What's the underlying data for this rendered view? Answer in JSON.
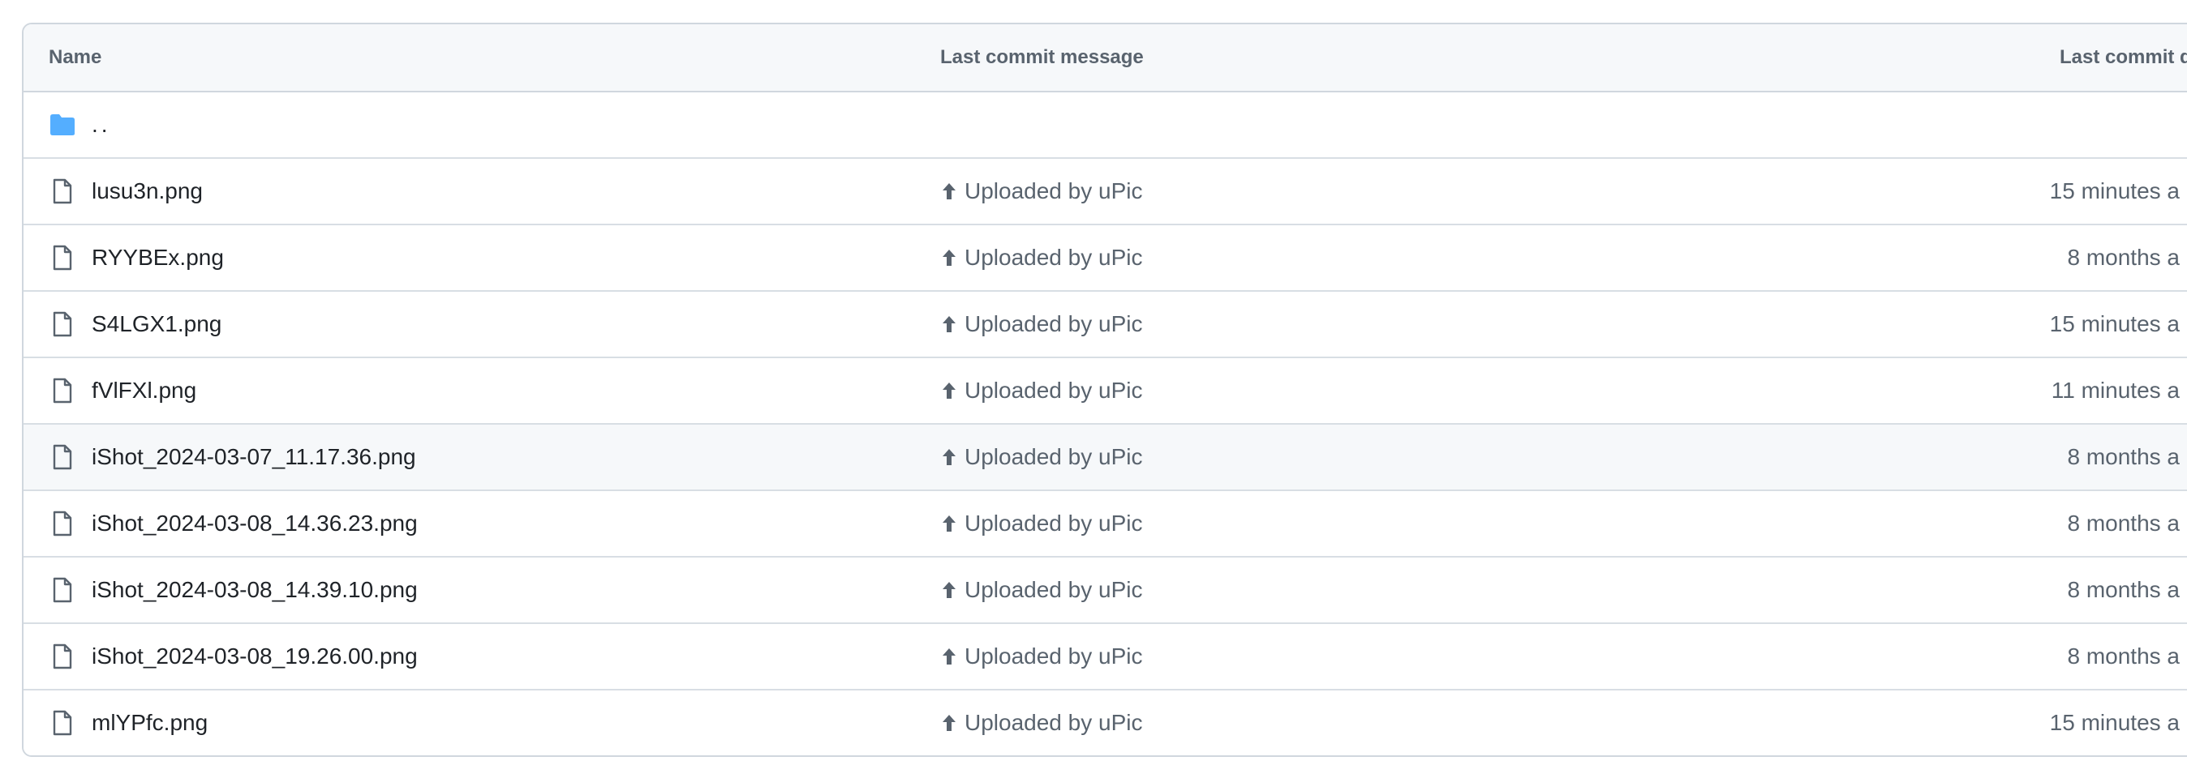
{
  "table": {
    "headers": {
      "name": "Name",
      "message": "Last commit message",
      "date": "Last commit d"
    },
    "parent": {
      "label": "..",
      "icon": "folder-icon",
      "color": "#54aeff"
    },
    "rows": [
      {
        "name": "lusu3n.png",
        "message": "Uploaded by uPic",
        "date": "15 minutes a",
        "highlight": false
      },
      {
        "name": "RYYBEx.png",
        "message": "Uploaded by uPic",
        "date": "8 months a",
        "highlight": false
      },
      {
        "name": "S4LGX1.png",
        "message": "Uploaded by uPic",
        "date": "15 minutes a",
        "highlight": false
      },
      {
        "name": "fVlFXl.png",
        "message": "Uploaded by uPic",
        "date": "11 minutes a",
        "highlight": false
      },
      {
        "name": "iShot_2024-03-07_11.17.36.png",
        "message": "Uploaded by uPic",
        "date": "8 months a",
        "highlight": true
      },
      {
        "name": "iShot_2024-03-08_14.36.23.png",
        "message": "Uploaded by uPic",
        "date": "8 months a",
        "highlight": false
      },
      {
        "name": "iShot_2024-03-08_14.39.10.png",
        "message": "Uploaded by uPic",
        "date": "8 months a",
        "highlight": false
      },
      {
        "name": "iShot_2024-03-08_19.26.00.png",
        "message": "Uploaded by uPic",
        "date": "8 months a",
        "highlight": false
      },
      {
        "name": "mlYPfc.png",
        "message": "Uploaded by uPic",
        "date": "15 minutes a",
        "highlight": false
      }
    ]
  },
  "icons": {
    "file": "file-icon",
    "upload_arrow": "arrow-up-icon"
  },
  "colors": {
    "border": "#d0d7de",
    "header_bg": "#f6f8fa",
    "muted_text": "#59636e",
    "primary_text": "#1f2328"
  }
}
